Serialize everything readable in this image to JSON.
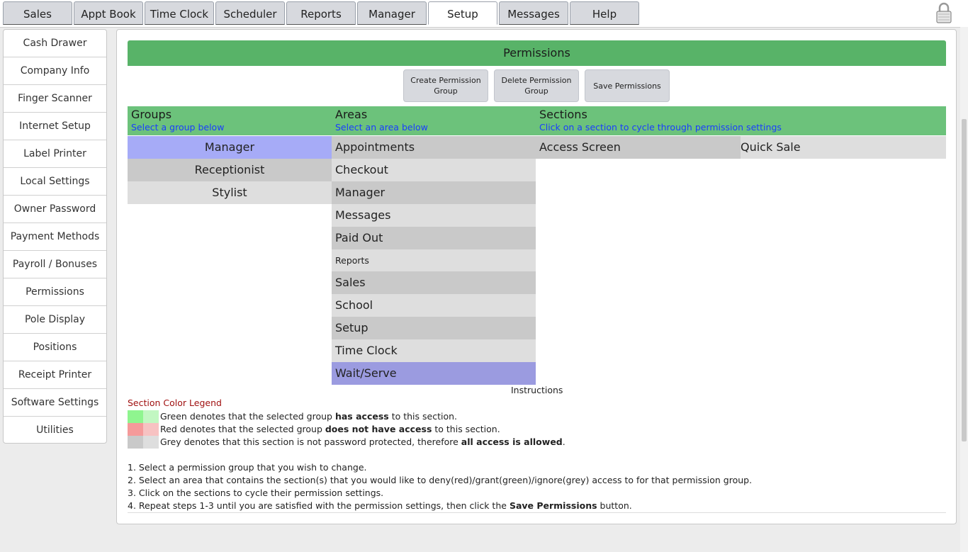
{
  "tabs": [
    "Sales",
    "Appt Book",
    "Time Clock",
    "Scheduler",
    "Reports",
    "Manager",
    "Setup",
    "Messages",
    "Help"
  ],
  "active_tab": "Setup",
  "sidebar": [
    "Cash Drawer",
    "Company Info",
    "Finger Scanner",
    "Internet Setup",
    "Label Printer",
    "Local Settings",
    "Owner Password",
    "Payment Methods",
    "Payroll / Bonuses",
    "Permissions",
    "Pole Display",
    "Positions",
    "Receipt Printer",
    "Software Settings",
    "Utilities"
  ],
  "page_title": "Permissions",
  "buttons": {
    "create": "Create Permission Group",
    "delete": "Delete Permission Group",
    "save": "Save Permissions"
  },
  "columns": {
    "groups": {
      "title": "Groups",
      "subtitle": "Select a group below"
    },
    "areas": {
      "title": "Areas",
      "subtitle": "Select an area below"
    },
    "sections": {
      "title": "Sections",
      "subtitle": "Click on a section to cycle through permission settings"
    }
  },
  "groups": [
    "Manager",
    "Receptionist",
    "Stylist"
  ],
  "selected_group": "Manager",
  "areas": [
    "Appointments",
    "Checkout",
    "Manager",
    "Messages",
    "Paid Out",
    "Reports",
    "Sales",
    "School",
    "Setup",
    "Time Clock",
    "Wait/Serve"
  ],
  "selected_area": "Wait/Serve",
  "sections": [
    "Access Screen",
    "Quick Sale"
  ],
  "instructions_title": "Instructions",
  "legend": {
    "title": "Section Color Legend",
    "green": {
      "pre": "Green denotes that the selected group ",
      "bold": "has access",
      "post": " to this section."
    },
    "red": {
      "pre": "Red denotes that the selected group ",
      "bold": "does not have access",
      "post": " to this section."
    },
    "grey": {
      "pre": "Grey denotes that this section is not password protected, therefore ",
      "bold": "all access is allowed",
      "post": "."
    }
  },
  "legend_colors": {
    "green": [
      "#8ff58f",
      "#c2f7c2"
    ],
    "red": [
      "#f59a9a",
      "#f7c2c2"
    ],
    "grey": [
      "#c9c9c9",
      "#dedede"
    ]
  },
  "steps": {
    "s1": "1. Select a permission group that you wish to change.",
    "s2": "2. Select an area that contains the section(s) that you would like to deny(red)/grant(green)/ignore(grey) access to for that permission group.",
    "s3": "3. Click on the sections to cycle their permission settings.",
    "s4_pre": "4. Repeat steps 1-3 until you are satisfied with the permission settings, then click the ",
    "s4_bold": "Save Permissions",
    "s4_post": " button."
  }
}
